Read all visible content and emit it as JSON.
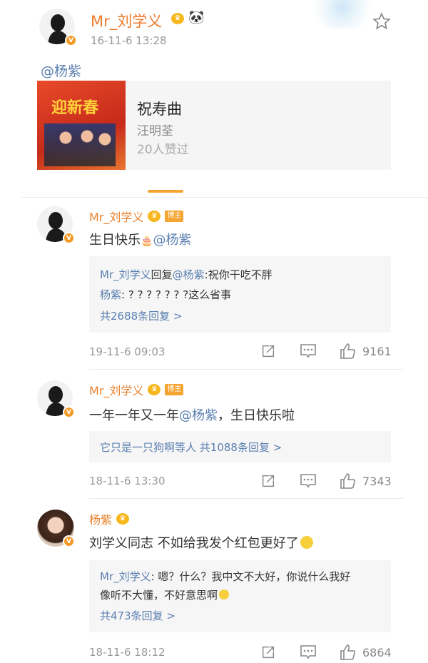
{
  "post": {
    "author": "Mr_刘学义",
    "time": "16-11-6 13:28",
    "mention": "@杨紫",
    "music": {
      "title": "祝寿曲",
      "artist": "汪明荃",
      "likes": "20人赞过",
      "cover_text": "迎新春"
    }
  },
  "comments": [
    {
      "name": "Mr_刘学义",
      "badge": "博主",
      "text_plain": "生日快乐",
      "text_mention": "@杨紫",
      "reply_lines": [
        {
          "user": "Mr_刘学义",
          "mid": "回复",
          "target": "@杨紫",
          "content": ":祝你干吃不胖"
        },
        {
          "user": "杨紫",
          "mid": "",
          "target": "",
          "content": ": ? ? ? ? ? ? ?这么省事"
        }
      ],
      "more": "共2688条回复 >",
      "time": "19-11-6 09:03",
      "likes": "9161"
    },
    {
      "name": "Mr_刘学义",
      "badge": "博主",
      "text_before": "一年一年又一年",
      "text_mention": "@杨紫",
      "text_after": "，生日快乐啦",
      "reply_prefix": "它只是一只狗啊等人",
      "more": "共1088条回复 >",
      "time": "18-11-6 13:30",
      "likes": "7343"
    },
    {
      "name": "杨紫",
      "text": "刘学义同志 不如给我发个红包更好了",
      "reply_user": "Mr_刘学义",
      "reply_l1": ": 嗯？什么？我中文不大好，你说什么我好",
      "reply_l2": "像听不大懂，不好意思啊",
      "more": "共473条回复 >",
      "time": "18-11-6 18:12",
      "likes": "6864"
    }
  ]
}
